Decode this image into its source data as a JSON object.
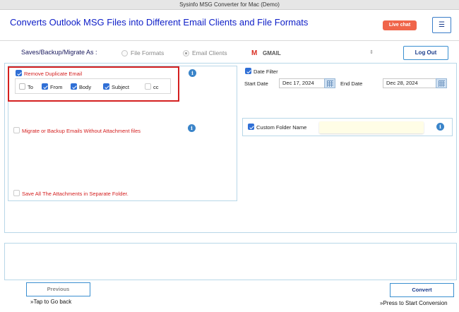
{
  "window": {
    "title": "Sysinfo MSG Converter for Mac (Demo)"
  },
  "header": {
    "title": "Converts Outlook MSG Files into Different Email Clients and File Formats",
    "live_chat": "Live chat",
    "menu_icon": "☰"
  },
  "save_options": {
    "label": "Saves/Backup/Migrate As :",
    "file_formats": "File Formats",
    "email_clients": "Email Clients",
    "selected": "Email Clients",
    "client_value": "GMAIL",
    "client_icon": "M",
    "logout": "Log Out"
  },
  "filters": {
    "remove_duplicate": {
      "label": "Remove Duplicate Email",
      "checked": true
    },
    "duplicate_fields": [
      {
        "label": "To",
        "checked": false
      },
      {
        "label": "From",
        "checked": true
      },
      {
        "label": "Body",
        "checked": true
      },
      {
        "label": "Subject",
        "checked": true
      },
      {
        "label": "cc",
        "checked": false
      }
    ],
    "without_attachment": {
      "label": "Migrate or Backup Emails Without Attachment files",
      "checked": false
    },
    "save_attachments": {
      "label": "Save All The Attachments in Separate Folder.",
      "checked": false
    },
    "date_filter": {
      "label": "Date Filter",
      "checked": true,
      "start_label": "Start Date",
      "start_value": "Dec 17, 2024",
      "end_label": "End Date",
      "end_value": "Dec 28, 2024"
    },
    "custom_folder": {
      "label": "Custom Folder Name",
      "checked": true,
      "value": ""
    },
    "info_icon": "i"
  },
  "footer": {
    "previous": "Previous",
    "previous_hint": "»Tap to Go back",
    "convert": "Convert",
    "convert_hint": "»Press to Start Conversion"
  },
  "colors": {
    "accent": "#1020c8",
    "danger": "#d42020",
    "live_chat": "#f0654a",
    "info": "#3a84c9"
  }
}
